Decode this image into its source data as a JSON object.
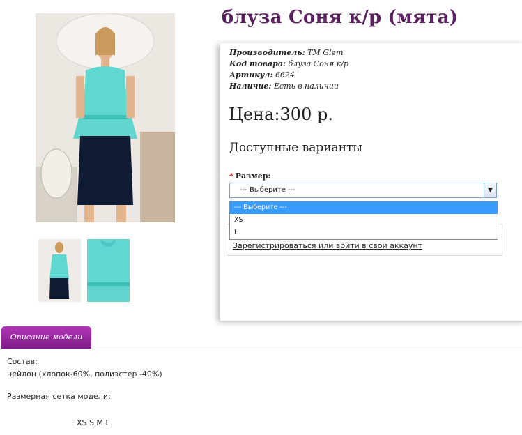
{
  "product": {
    "title": "блуза Соня к/р (мята)",
    "meta": [
      {
        "key": "Производитель:",
        "value": "TM Glem"
      },
      {
        "key": "Код товара:",
        "value": "блуза Соня к/р"
      },
      {
        "key": "Артикул:",
        "value": "6624"
      },
      {
        "key": "Наличие:",
        "value": "Есть в наличии"
      }
    ],
    "price": "Цена:300 р."
  },
  "variants": {
    "heading": "Доступные варианты",
    "size_label": "Размер:",
    "required_mark": "*",
    "select_value": "--- Выберите ---",
    "options": [
      "--- Выберите ---",
      "XS",
      "L"
    ]
  },
  "account": {
    "link": "Зарегистрироваться или войти в свой аккаунт"
  },
  "tabs": [
    {
      "label": "Описание модели"
    }
  ],
  "description": {
    "composition_label": "Состав:",
    "composition": "нейлон (хлопок-60%, полиэстер -40%)",
    "size_chart_label": "Размерная сетка модели:",
    "sizes": "XS S M L"
  },
  "colors": {
    "title": "#5a2060",
    "tab": "#9a2aa3",
    "blouse": "#5fd8d2",
    "skirt": "#0f1a33",
    "selected_option": "#3b9cff"
  }
}
